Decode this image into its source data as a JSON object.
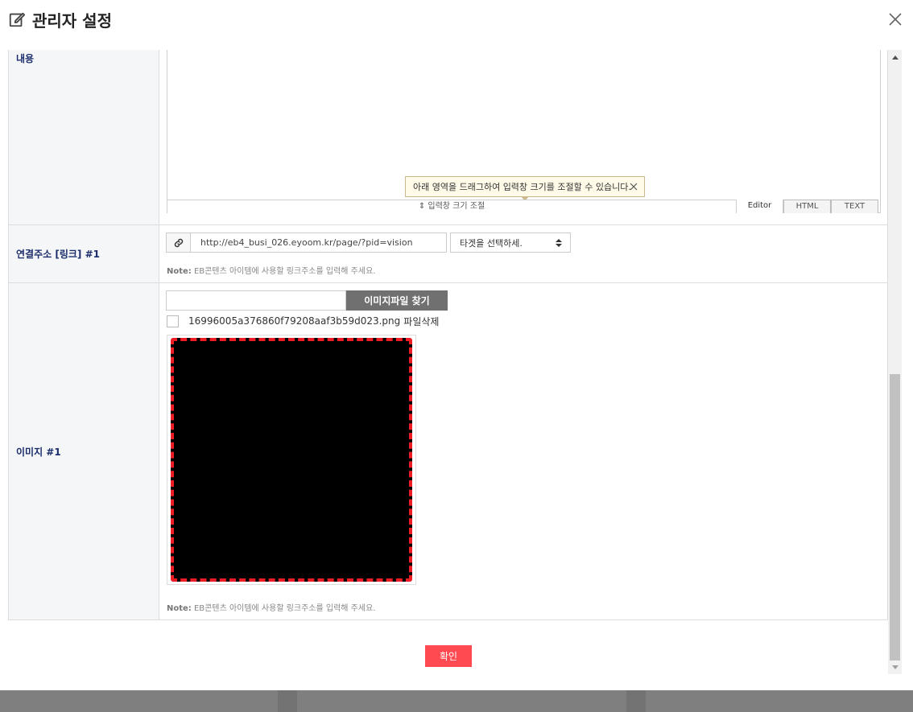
{
  "modal": {
    "title": "관리자 설정",
    "title_icon": "edit-icon",
    "close_icon": "close-icon"
  },
  "editor": {
    "label": "내용",
    "tooltip": "아래 영역을 드래그하여 입력창 크기를 조절할 수 있습니다.",
    "resize_label": "⇕ 입력창 크기 조절",
    "tabs": [
      "Editor",
      "HTML",
      "TEXT"
    ],
    "active_tab": "Editor"
  },
  "link": {
    "label": "연결주소 [링크] #1",
    "icon": "link-icon",
    "url": "http://eb4_busi_026.eyoom.kr/page/?pid=vision",
    "target_select": "타겟을 선택하세.",
    "note_prefix": "Note:",
    "note_text": " EB콘텐츠 아이템에 사용할 링크주소를 입력해 주세요."
  },
  "image": {
    "label": "이미지 #1",
    "file_button": "이미지파일 찾기",
    "filename": "16996005a376860f79208aaf3b59d023.png",
    "delete_label": "파일삭제",
    "note_prefix": "Note:",
    "note_text": " EB콘텐츠 아이템에 사용할 링크주소를 입력해 주세요."
  },
  "confirm_label": "확인",
  "colors": {
    "confirm": "#ff4a52",
    "label_text": "#1a2c6b",
    "dash_border": "#ee1c25"
  }
}
